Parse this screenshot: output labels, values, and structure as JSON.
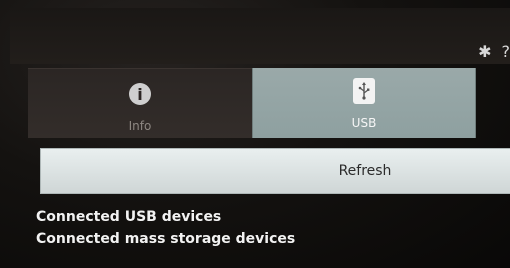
{
  "tabs": [
    {
      "label": "Info",
      "icon": "info-icon",
      "selected": false
    },
    {
      "label": "USB",
      "icon": "usb-icon",
      "selected": true
    }
  ],
  "status_bar": {
    "icons": [
      "bluetooth-icon",
      "wifi-icon"
    ]
  },
  "actions": {
    "refresh_label": "Refresh"
  },
  "sections": {
    "connected_usb": "Connected USB devices",
    "connected_mass_storage": "Connected mass storage devices"
  },
  "colors": {
    "selected_tab": "#95a6a6",
    "unselected_tab": "#2f2926",
    "button": "#dfe5e5",
    "text": "#f2f2f2"
  }
}
